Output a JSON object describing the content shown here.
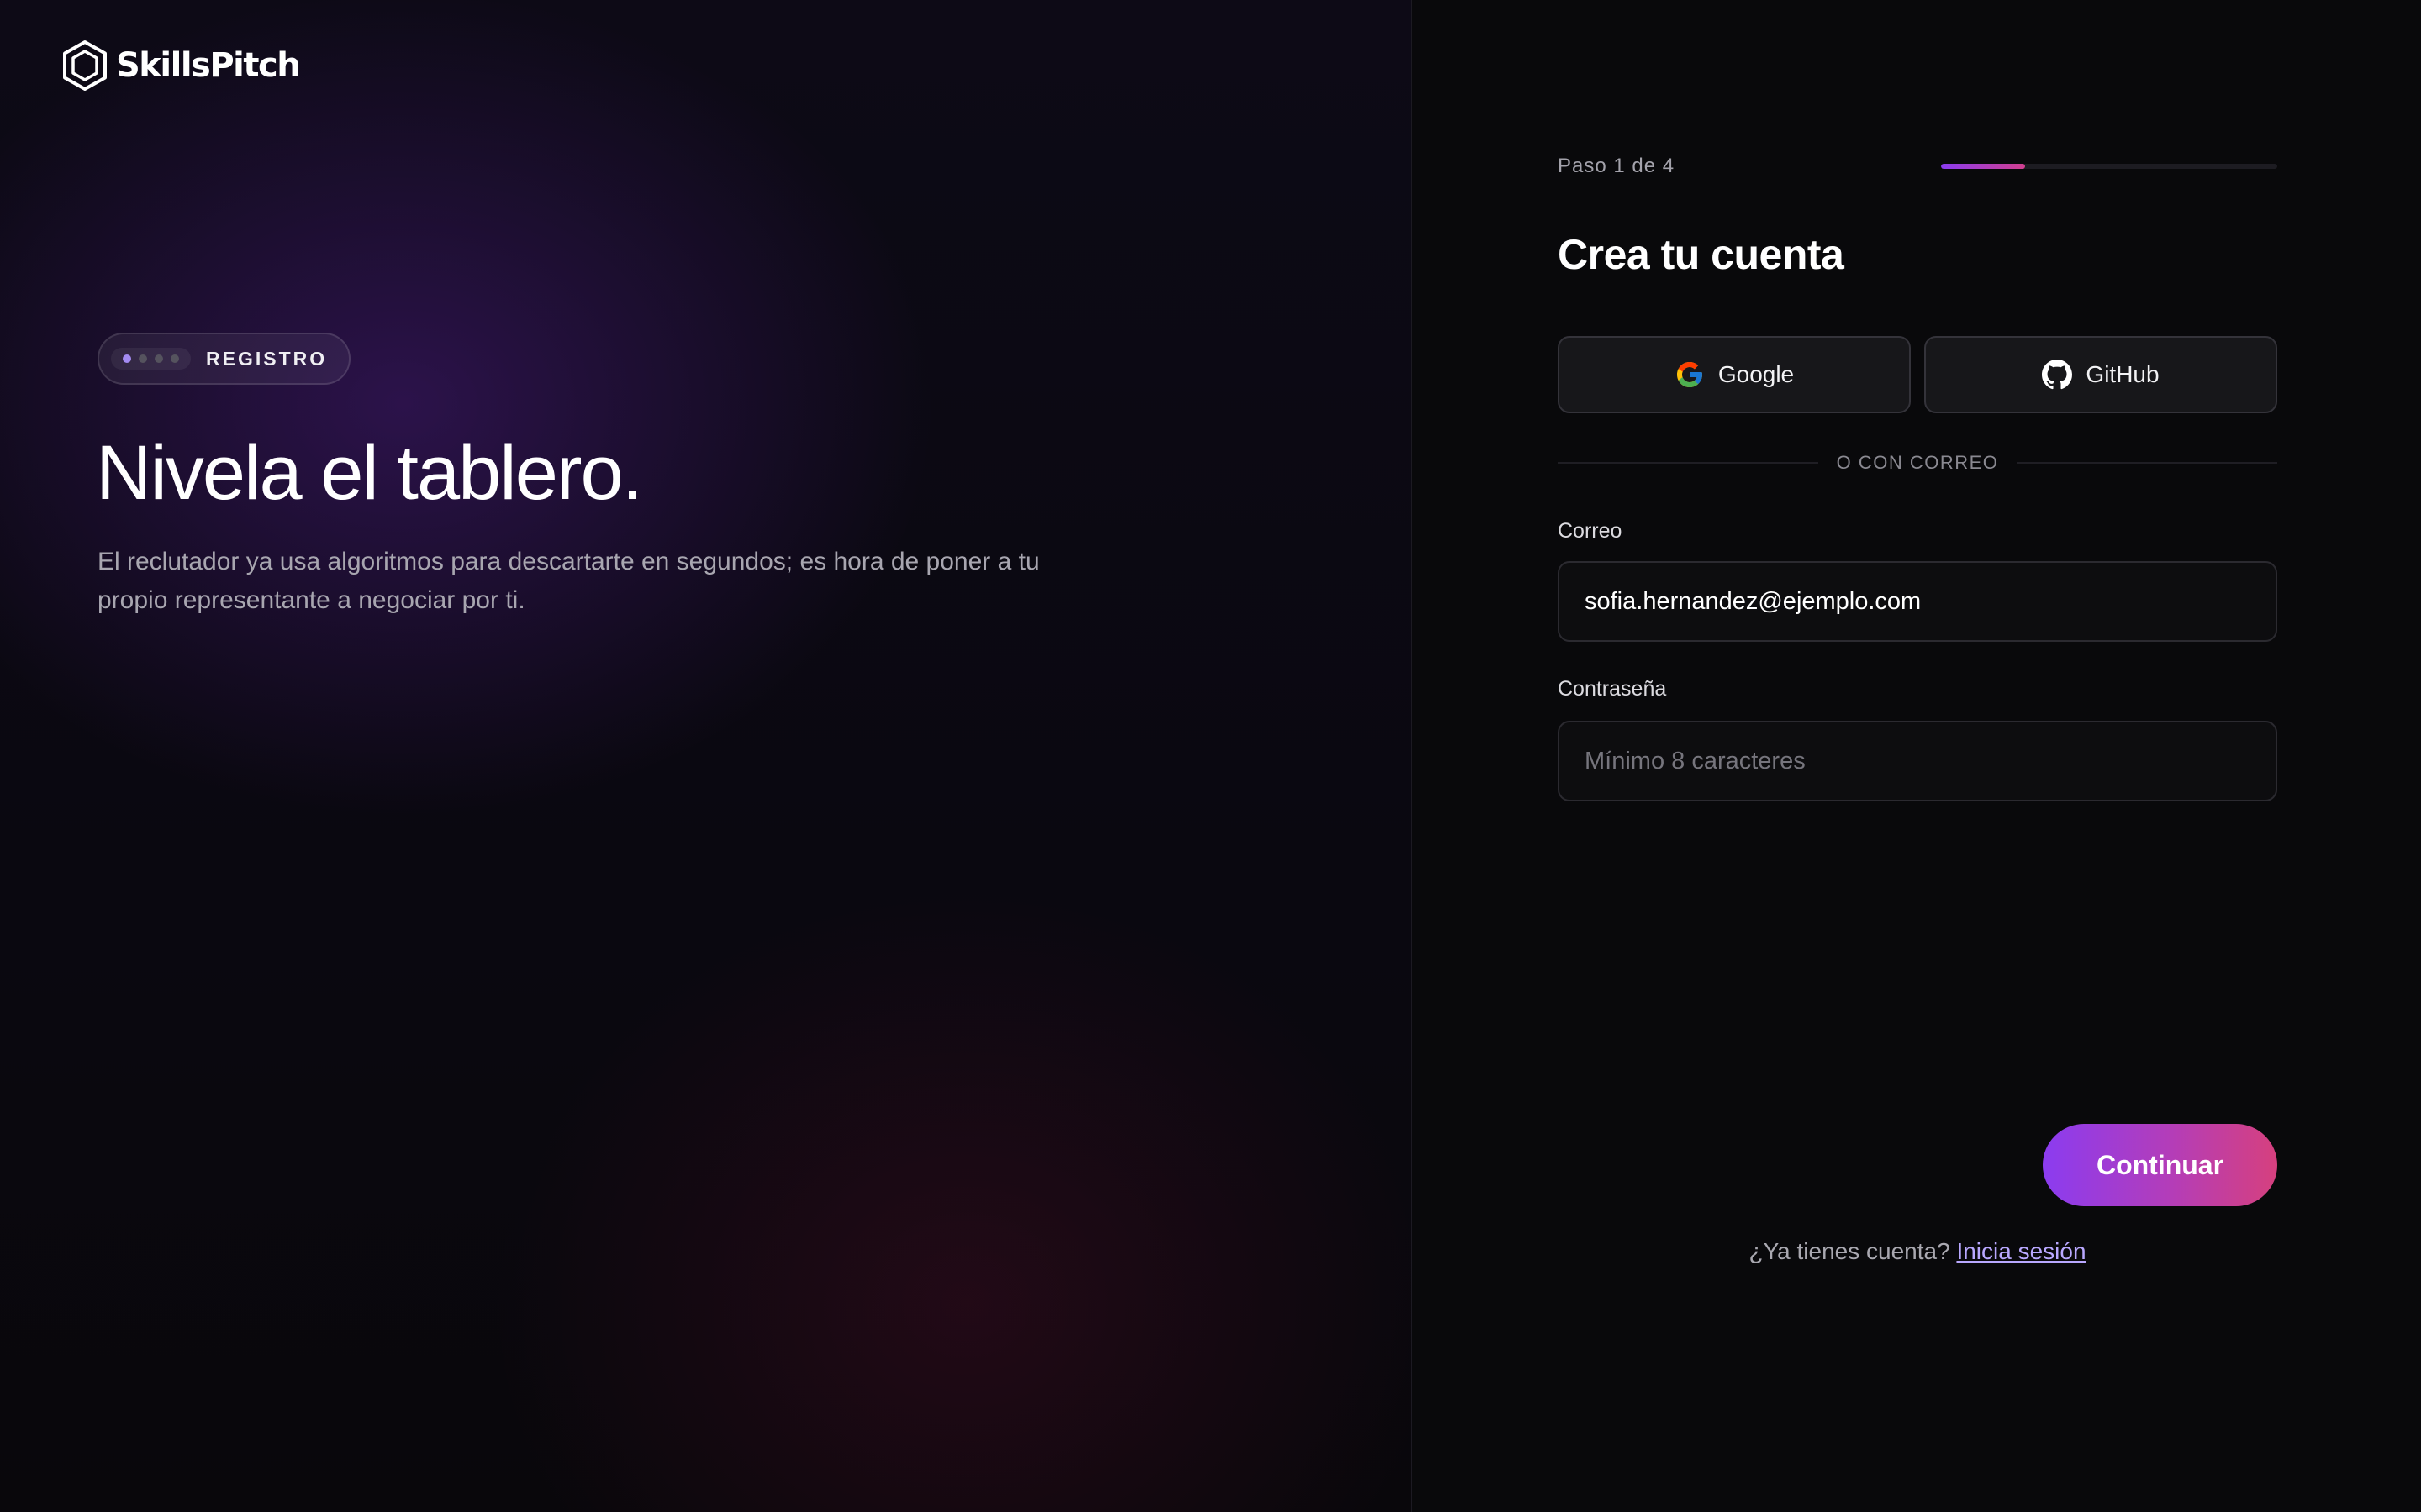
{
  "brand": {
    "name": "SkillsPitch"
  },
  "hero": {
    "badge_label": "REGISTRO",
    "badge_step_dots": 4,
    "badge_active_dot": 1,
    "title": "Nivela el tablero.",
    "subtitle": "El reclutador ya usa algoritmos para descartarte en segundos; es hora de poner a tu propio representante a negociar por ti."
  },
  "form": {
    "step_label": "Paso 1 de 4",
    "step_progress": 0.25,
    "title": "Crea tu cuenta",
    "social": [
      {
        "label": "Google",
        "icon": "google-icon"
      },
      {
        "label": "GitHub",
        "icon": "github-icon"
      }
    ],
    "divider_text": "O CON CORREO",
    "email": {
      "label": "Correo",
      "value": "sofia.hernandez@ejemplo.com",
      "placeholder": ""
    },
    "password": {
      "label": "Contraseña",
      "value": "",
      "placeholder": "Mínimo 8 caracteres"
    },
    "continue_label": "Continuar",
    "login_prompt": "¿Ya tienes cuenta?",
    "login_link": "Inicia sesión"
  },
  "colors": {
    "accent_start": "#8b3cf0",
    "accent_end": "#d6407e",
    "link": "#b9a8ff",
    "background": "#08080a"
  }
}
